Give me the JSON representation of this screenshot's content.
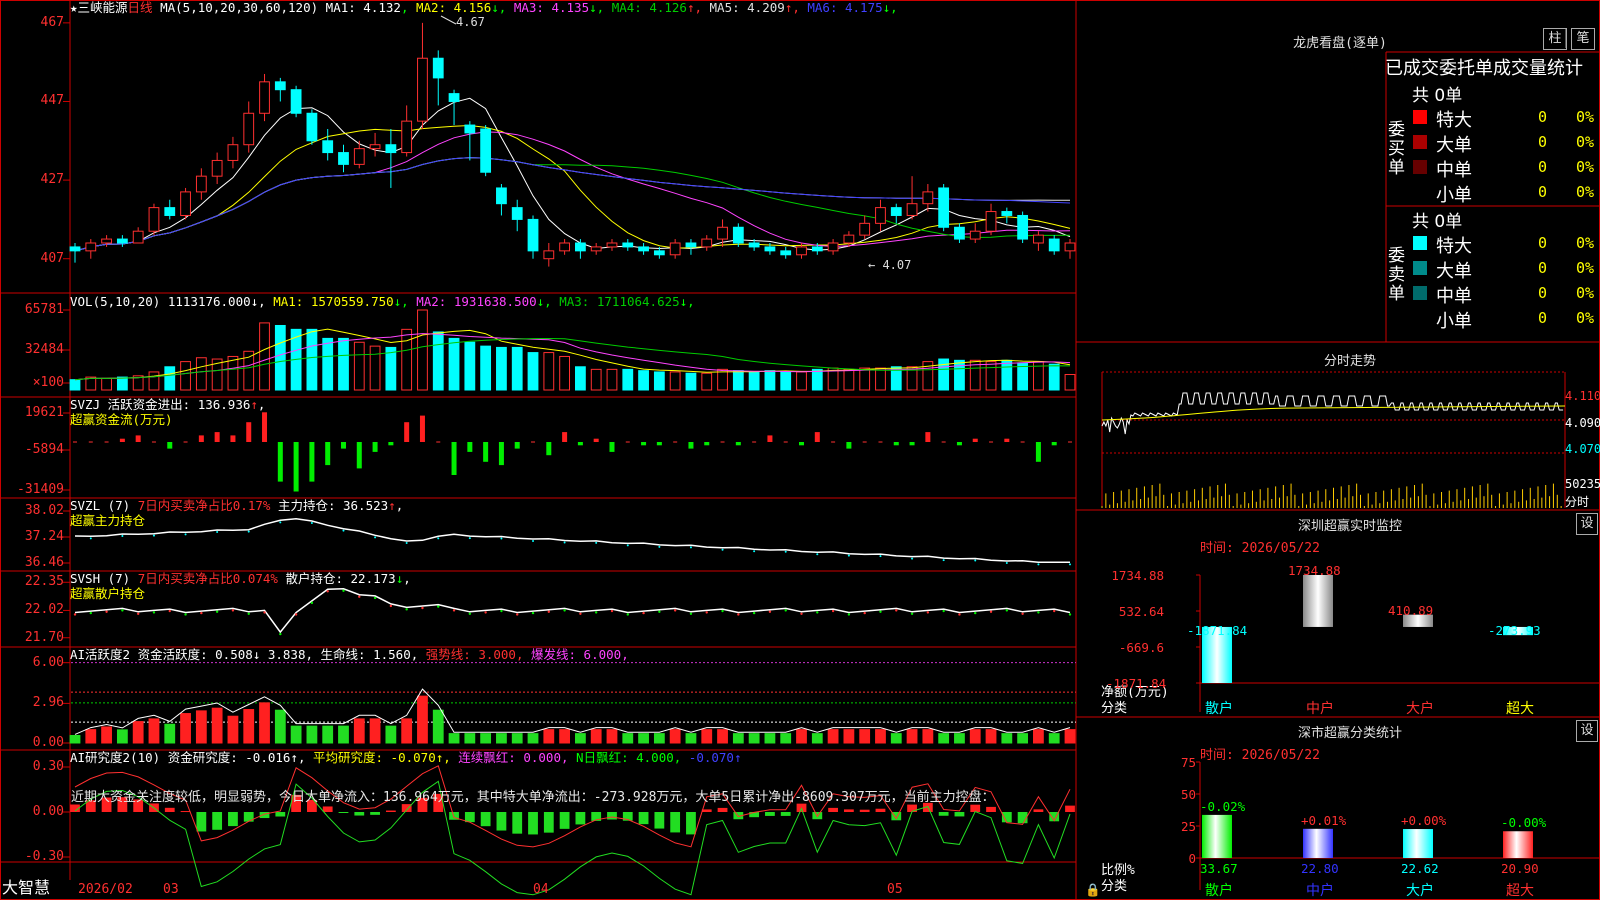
{
  "chart_data": [
    {
      "type": "candlestick",
      "title": "三峡能源",
      "period": "日线",
      "ma_params": "MA(5,10,20,30,60,120)",
      "ylim": [
        403,
        469
      ],
      "yticks": [
        "467",
        "447",
        "427",
        "407"
      ],
      "annotations": {
        "high": "4.67",
        "low": "4.07"
      },
      "indicators": [
        {
          "name": "MA1",
          "value": "4.132",
          "dir": "",
          "color": "#ffffff"
        },
        {
          "name": "MA2",
          "value": "4.156",
          "dir": "↓",
          "color": "#ffff00"
        },
        {
          "name": "MA3",
          "value": "4.135",
          "dir": "↓",
          "color": "#ff44ff"
        },
        {
          "name": "MA4",
          "value": "4.126",
          "dir": "↑",
          "color": "#00cc00"
        },
        {
          "name": "MA5",
          "value": "4.209",
          "dir": "↑",
          "color": "#e0e0e0"
        },
        {
          "name": "MA6",
          "value": "4.175",
          "dir": "↓",
          "color": "#4040ff"
        }
      ],
      "candles": [
        {
          "o": 410,
          "c": 409,
          "h": 411,
          "l": 406
        },
        {
          "o": 409,
          "c": 411,
          "h": 412,
          "l": 407
        },
        {
          "o": 411,
          "c": 412,
          "h": 413,
          "l": 410
        },
        {
          "o": 412,
          "c": 411,
          "h": 413,
          "l": 410
        },
        {
          "o": 411,
          "c": 414,
          "h": 415,
          "l": 411
        },
        {
          "o": 414,
          "c": 420,
          "h": 421,
          "l": 413
        },
        {
          "o": 420,
          "c": 418,
          "h": 422,
          "l": 417
        },
        {
          "o": 418,
          "c": 424,
          "h": 425,
          "l": 417
        },
        {
          "o": 424,
          "c": 428,
          "h": 430,
          "l": 422
        },
        {
          "o": 428,
          "c": 432,
          "h": 434,
          "l": 426
        },
        {
          "o": 432,
          "c": 436,
          "h": 438,
          "l": 430
        },
        {
          "o": 436,
          "c": 444,
          "h": 447,
          "l": 434
        },
        {
          "o": 444,
          "c": 452,
          "h": 454,
          "l": 442
        },
        {
          "o": 452,
          "c": 450,
          "h": 453,
          "l": 447
        },
        {
          "o": 450,
          "c": 444,
          "h": 451,
          "l": 443
        },
        {
          "o": 444,
          "c": 437,
          "h": 445,
          "l": 436
        },
        {
          "o": 437,
          "c": 434,
          "h": 440,
          "l": 432
        },
        {
          "o": 434,
          "c": 431,
          "h": 436,
          "l": 429
        },
        {
          "o": 431,
          "c": 435,
          "h": 437,
          "l": 430
        },
        {
          "o": 435,
          "c": 436,
          "h": 439,
          "l": 433
        },
        {
          "o": 436,
          "c": 434,
          "h": 440,
          "l": 425
        },
        {
          "o": 434,
          "c": 442,
          "h": 446,
          "l": 433
        },
        {
          "o": 442,
          "c": 458,
          "h": 467,
          "l": 440
        },
        {
          "o": 458,
          "c": 453,
          "h": 460,
          "l": 446
        },
        {
          "o": 449,
          "c": 447,
          "h": 450,
          "l": 441
        },
        {
          "o": 441,
          "c": 439,
          "h": 442,
          "l": 432
        },
        {
          "o": 440,
          "c": 429,
          "h": 441,
          "l": 428
        },
        {
          "o": 425,
          "c": 421,
          "h": 426,
          "l": 418
        },
        {
          "o": 420,
          "c": 417,
          "h": 422,
          "l": 414
        },
        {
          "o": 417,
          "c": 409,
          "h": 418,
          "l": 407
        },
        {
          "o": 407,
          "c": 409,
          "h": 411,
          "l": 405
        },
        {
          "o": 409,
          "c": 411,
          "h": 412,
          "l": 408
        },
        {
          "o": 411,
          "c": 409,
          "h": 412,
          "l": 407
        },
        {
          "o": 409,
          "c": 410,
          "h": 411,
          "l": 408
        },
        {
          "o": 410,
          "c": 411,
          "h": 412,
          "l": 409
        },
        {
          "o": 411,
          "c": 410,
          "h": 412,
          "l": 409
        },
        {
          "o": 410,
          "c": 409,
          "h": 411,
          "l": 408
        },
        {
          "o": 409,
          "c": 408,
          "h": 410,
          "l": 407
        },
        {
          "o": 408,
          "c": 411,
          "h": 412,
          "l": 407
        },
        {
          "o": 411,
          "c": 410,
          "h": 412,
          "l": 408
        },
        {
          "o": 410,
          "c": 412,
          "h": 413,
          "l": 409
        },
        {
          "o": 412,
          "c": 415,
          "h": 417,
          "l": 410
        },
        {
          "o": 415,
          "c": 411,
          "h": 416,
          "l": 410
        },
        {
          "o": 411,
          "c": 410,
          "h": 412,
          "l": 409
        },
        {
          "o": 410,
          "c": 409,
          "h": 411,
          "l": 408
        },
        {
          "o": 409,
          "c": 408,
          "h": 410,
          "l": 407
        },
        {
          "o": 408,
          "c": 410,
          "h": 411,
          "l": 407
        },
        {
          "o": 410,
          "c": 409,
          "h": 411,
          "l": 408
        },
        {
          "o": 409,
          "c": 411,
          "h": 412,
          "l": 408
        },
        {
          "o": 411,
          "c": 413,
          "h": 414,
          "l": 410
        },
        {
          "o": 413,
          "c": 416,
          "h": 418,
          "l": 412
        },
        {
          "o": 416,
          "c": 420,
          "h": 422,
          "l": 414
        },
        {
          "o": 420,
          "c": 418,
          "h": 421,
          "l": 416
        },
        {
          "o": 418,
          "c": 421,
          "h": 428,
          "l": 417
        },
        {
          "o": 421,
          "c": 424,
          "h": 426,
          "l": 419
        },
        {
          "o": 425,
          "c": 415,
          "h": 426,
          "l": 414
        },
        {
          "o": 415,
          "c": 412,
          "h": 416,
          "l": 411
        },
        {
          "o": 412,
          "c": 414,
          "h": 416,
          "l": 411
        },
        {
          "o": 414,
          "c": 419,
          "h": 421,
          "l": 413
        },
        {
          "o": 419,
          "c": 418,
          "h": 420,
          "l": 416
        },
        {
          "o": 418,
          "c": 412,
          "h": 419,
          "l": 411
        },
        {
          "o": 411,
          "c": 413,
          "h": 414,
          "l": 409
        },
        {
          "o": 412,
          "c": 409,
          "h": 413,
          "l": 408
        },
        {
          "o": 409,
          "c": 411,
          "h": 412,
          "l": 407
        }
      ]
    },
    {
      "type": "bar",
      "title": "VOL(5,10,20)",
      "value": "1113176.000",
      "yticks": [
        "65781",
        "32484",
        "×100"
      ],
      "indicators": [
        {
          "name": "MA1",
          "value": "1570559.750",
          "dir": "↓",
          "color": "#ffff00"
        },
        {
          "name": "MA2",
          "value": "1931638.500",
          "dir": "↓",
          "color": "#ff44ff"
        },
        {
          "name": "MA3",
          "value": "1711064.625",
          "dir": "↓",
          "color": "#00cc00"
        }
      ],
      "values": [
        8,
        10,
        9,
        10,
        11,
        14,
        18,
        22,
        25,
        24,
        26,
        30,
        52,
        50,
        47,
        47,
        40,
        40,
        37,
        34,
        33,
        47,
        62,
        45,
        40,
        37,
        34,
        33,
        33,
        29,
        29,
        26,
        18,
        16,
        16,
        16,
        15,
        14,
        14,
        13,
        13,
        16,
        15,
        14,
        15,
        14,
        14,
        16,
        17,
        16,
        17,
        17,
        18,
        18,
        22,
        24,
        23,
        23,
        22,
        23,
        21,
        22,
        20,
        12
      ]
    },
    {
      "type": "bar",
      "title": "SVZJ",
      "subtitle": "超赢资金流(万元)",
      "label": "活跃资金进出:",
      "value": "136.936",
      "dir": "↑",
      "yticks": [
        "19621",
        "-5894",
        "-31409"
      ],
      "values": [
        0,
        0,
        0,
        1,
        2,
        0,
        -2,
        0,
        2,
        3,
        2,
        6,
        9,
        -12,
        -15,
        -12,
        -7,
        -2,
        -8,
        -3,
        -1,
        6,
        8,
        0,
        -10,
        -3,
        -6,
        -7,
        -2,
        0,
        -4,
        3,
        -1,
        1,
        -3,
        0,
        -1,
        -1,
        0,
        -2,
        -1,
        0,
        -1,
        0,
        2,
        0,
        -1,
        3,
        0,
        -2,
        0,
        0,
        -1,
        -1,
        3,
        0,
        -1,
        1,
        0,
        1,
        0,
        -6,
        -1,
        0,
        1,
        -2,
        0,
        2,
        -5,
        -3
      ]
    },
    {
      "type": "line",
      "title": "SVZL (7)",
      "subtitle": "超赢主力持仓",
      "text1": "7日内买卖净占比0.17%",
      "label": "主力持仓:",
      "value": "36.523",
      "dir": "↑",
      "yticks": [
        "38.02",
        "37.24",
        "36.46"
      ],
      "ylim": [
        36.4,
        38.2
      ]
    },
    {
      "type": "line",
      "title": "SVSH (7)",
      "subtitle": "超赢散户持仓",
      "text1": "7日内买卖净占比0.074%",
      "label": "散户持仓:",
      "value": "22.173",
      "dir": "↓",
      "yticks": [
        "22.35",
        "22.02",
        "21.70"
      ],
      "ylim": [
        21.65,
        22.4
      ]
    },
    {
      "type": "bar",
      "title": "AI活跃度2",
      "items": [
        {
          "label": "资金活跃度:",
          "value": "0.508",
          "dir": "↓",
          "color": "#ffffff"
        },
        {
          "label": "",
          "value": "3.838",
          "dir": ",",
          "color": "#ffffff"
        },
        {
          "label": "生命线:",
          "value": "1.560",
          "dir": ",",
          "color": "#ffffff"
        },
        {
          "label": "强势线:",
          "value": "3.000",
          "dir": ",",
          "color": "#ff3030"
        },
        {
          "label": "爆发线:",
          "value": "6.000",
          "dir": ",",
          "color": "#ff44ff"
        }
      ],
      "yticks": [
        "6.00",
        "2.96",
        "0.00"
      ],
      "ylim": [
        0,
        6.2
      ]
    },
    {
      "type": "bar",
      "title": "AI研究度2(10)",
      "items": [
        {
          "label": "资金研究度:",
          "value": "-0.016",
          "dir": "↑,",
          "color": "#ffffff"
        },
        {
          "label": "平均研究度:",
          "value": "-0.070",
          "dir": "↑,",
          "color": "#ffff00"
        },
        {
          "label": "连续飘红:",
          "value": "0.000",
          "dir": ",",
          "color": "#ff44ff"
        },
        {
          "label": "N日飘红:",
          "value": "4.000",
          "dir": ",",
          "color": "#00ff00"
        },
        {
          "label": "",
          "value": "-0.070",
          "dir": "↑",
          "color": "#4040ff"
        }
      ],
      "note": "近期大资金关注度较低，明显弱势，今日大单净流入：136.964万元，其中特大单净流出：-273.928万元，大单5日累计净出-8609.307万元，当前主力控盘：",
      "yticks": [
        "0.30",
        "0.00",
        "-0.30"
      ],
      "ylim": [
        -0.32,
        0.32
      ]
    }
  ],
  "xaxis": {
    "labels": [
      "2026/02",
      "03",
      "04",
      "05"
    ],
    "corner": "大智慧"
  },
  "right_panel": {
    "dragon": {
      "title": "龙虎看盘(逐单)",
      "btn_a": "柱",
      "btn_b": "笔",
      "tabs": "已成交委托单成交量统计",
      "buy": {
        "side": "委买单",
        "total": "共 0单",
        "rows": [
          {
            "label": "特大",
            "n": "0",
            "p": "0%",
            "color": "#ff0000"
          },
          {
            "label": "大单",
            "n": "0",
            "p": "0%",
            "color": "#aa0000"
          },
          {
            "label": "中单",
            "n": "0",
            "p": "0%",
            "color": "#660000"
          },
          {
            "label": "小单",
            "n": "0",
            "p": "0%",
            "color": "#000000"
          }
        ]
      },
      "sell": {
        "side": "委卖单",
        "total": "共 0单",
        "rows": [
          {
            "label": "特大",
            "n": "0",
            "p": "0%",
            "color": "#00ffff"
          },
          {
            "label": "大单",
            "n": "0",
            "p": "0%",
            "color": "#008b8b"
          },
          {
            "label": "中单",
            "n": "0",
            "p": "0%",
            "color": "#006b6b"
          },
          {
            "label": "小单",
            "n": "0",
            "p": "0%",
            "color": "#000000"
          }
        ]
      }
    },
    "intraday": {
      "title": "分时走势",
      "p1": "4.110",
      "p2": "4.090",
      "p3": "4.070",
      "vol": "50235",
      "fen": "分时"
    },
    "monitor": {
      "title": "深圳超赢实时监控",
      "settings": "设",
      "time": "时间: 2026/05/22",
      "yticks": [
        "1734.88",
        "532.64",
        "-669.6",
        "-1871.84"
      ],
      "ylim": [
        -1871.84,
        1734.88
      ],
      "ylabel": "净额(万元)",
      "xlabel": "分类",
      "categories": [
        "散户",
        "中户",
        "大户",
        "超大"
      ],
      "values": [
        -1871.84,
        1734.88,
        410.89,
        -273.93
      ],
      "labels": [
        "-1871.84",
        "1734.88",
        "410.89",
        "-273.93"
      ]
    },
    "stats": {
      "title": "深市超赢分类统计",
      "settings": "设",
      "time": "时间: 2026/05/22",
      "yticks": [
        "75",
        "50",
        "25",
        "0"
      ],
      "ylim": [
        0,
        75
      ],
      "ylabel": "比例%",
      "xlabel": "分类",
      "categories": [
        "散户",
        "中户",
        "大户",
        "超大"
      ],
      "values": [
        33.67,
        22.8,
        22.62,
        20.9
      ],
      "changes": [
        "-0.02%",
        "+0.01%",
        "+0.00%",
        "-0.00%"
      ],
      "labels": [
        "33.67",
        "22.80",
        "22.62",
        "20.90"
      ]
    }
  }
}
